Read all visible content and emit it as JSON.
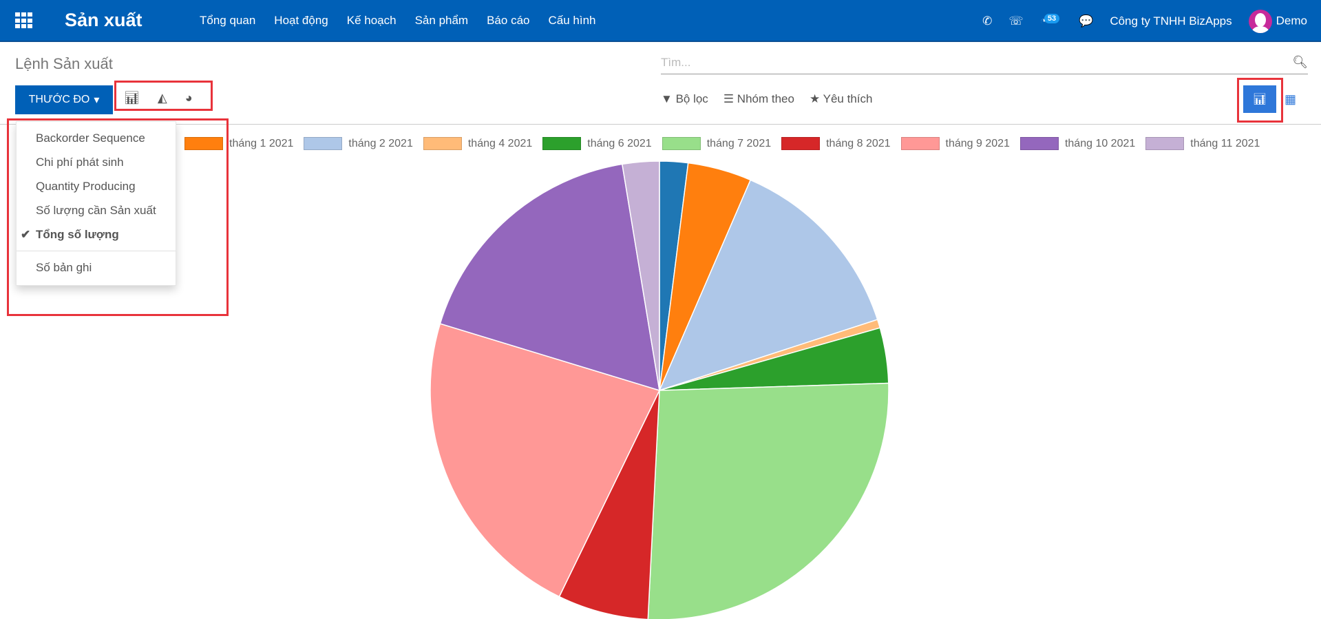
{
  "navbar": {
    "app_title": "Sản xuất",
    "menu": [
      "Tổng quan",
      "Hoạt động",
      "Kế hoạch",
      "Sản phẩm",
      "Báo cáo",
      "Cấu hình"
    ],
    "activity_count": "53",
    "company": "Công ty TNHH BizApps",
    "user": "Demo"
  },
  "page": {
    "title": "Lệnh Sản xuất"
  },
  "search": {
    "placeholder": "Tìm...",
    "value": ""
  },
  "toolbar": {
    "measure_label": "THƯỚC ĐO",
    "filter_label": "Bộ lọc",
    "groupby_label": "Nhóm theo",
    "favorites_label": "Yêu thích"
  },
  "measures_menu": {
    "items": [
      "Backorder Sequence",
      "Chi phí phát sinh",
      "Quantity Producing",
      "Số lượng cần Sản xuất",
      "Tổng số lượng"
    ],
    "selected": "Tổng số lượng",
    "count_item": "Số bản ghi"
  },
  "chart_data": {
    "type": "pie",
    "legend_position": "top",
    "series": [
      {
        "name": "",
        "value": 2.0,
        "color": "#1f77b4"
      },
      {
        "name": "tháng 1 2021",
        "value": 4.5,
        "color": "#ff7f0e"
      },
      {
        "name": "tháng 2 2021",
        "value": 13.5,
        "color": "#aec7e8"
      },
      {
        "name": "tháng 4 2021",
        "value": 0.6,
        "color": "#ffbb78"
      },
      {
        "name": "tháng 6 2021",
        "value": 3.9,
        "color": "#2ca02c"
      },
      {
        "name": "tháng 7 2021",
        "value": 26.3,
        "color": "#98df8a"
      },
      {
        "name": "tháng 8 2021",
        "value": 6.4,
        "color": "#d62728"
      },
      {
        "name": "tháng 9 2021",
        "value": 22.5,
        "color": "#ff9896"
      },
      {
        "name": "tháng 10 2021",
        "value": 17.7,
        "color": "#9467bd"
      },
      {
        "name": "tháng 11 2021",
        "value": 2.6,
        "color": "#c5b0d5"
      }
    ]
  }
}
